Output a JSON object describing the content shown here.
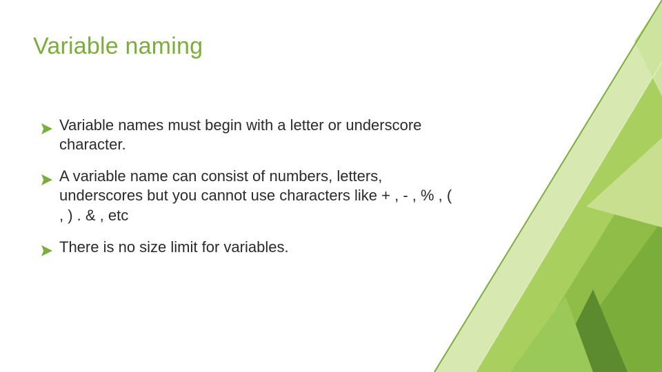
{
  "title": "Variable naming",
  "bullets": [
    {
      "text": "Variable names must begin with a letter or underscore character."
    },
    {
      "text": "A variable name can consist of numbers, letters, underscores but you cannot use characters like + , - , % , ( , ) . & , etc"
    },
    {
      "text": "There is no size limit for variables."
    }
  ],
  "colors": {
    "accent": "#7aad3a",
    "accent_light": "#a9cf5f",
    "accent_pale": "#d7e8b0",
    "accent_dark": "#5c8a2e",
    "text": "#2a2a2a"
  }
}
